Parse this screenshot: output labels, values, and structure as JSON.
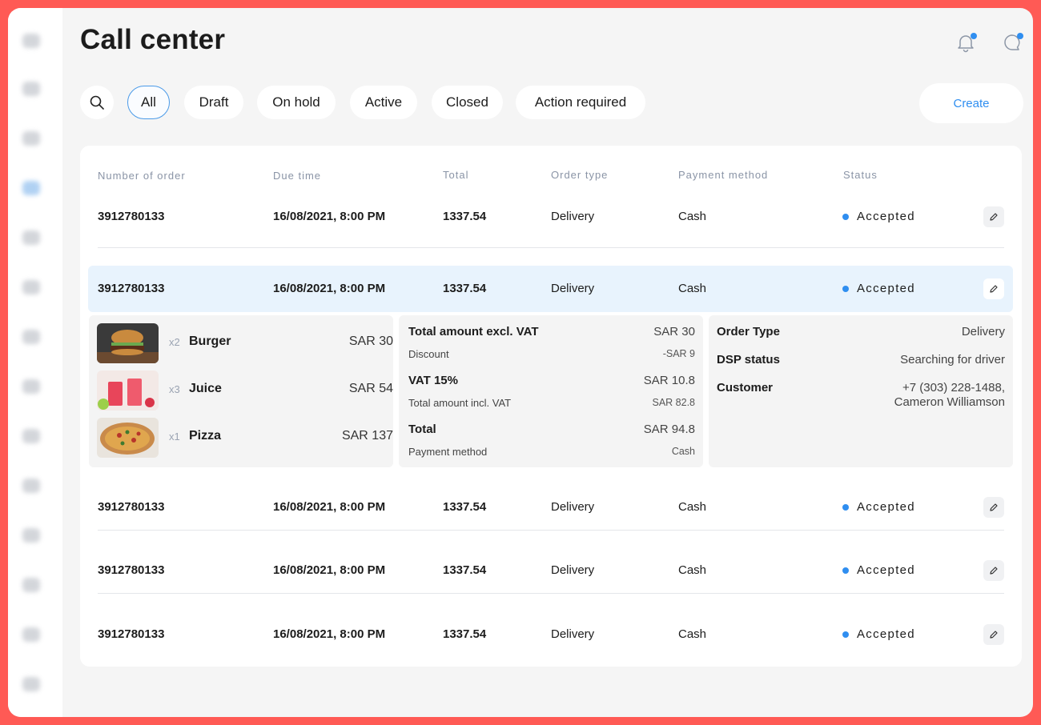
{
  "page": {
    "title": "Call center"
  },
  "filters": [
    "All",
    "Draft",
    "On hold",
    "Active",
    "Closed",
    "Action required"
  ],
  "create_label": "Create",
  "table": {
    "headers": [
      "Number of order",
      "Due time",
      "Total",
      "Order type",
      "Payment method",
      "Status"
    ],
    "rows": [
      {
        "number": "3912780133",
        "due": "16/08/2021, 8:00 PM",
        "total": "1337.54",
        "type": "Delivery",
        "payment": "Cash",
        "status": "Accepted"
      },
      {
        "number": "3912780133",
        "due": "16/08/2021, 8:00 PM",
        "total": "1337.54",
        "type": "Delivery",
        "payment": "Cash",
        "status": "Accepted"
      },
      {
        "number": "3912780133",
        "due": "16/08/2021, 8:00 PM",
        "total": "1337.54",
        "type": "Delivery",
        "payment": "Cash",
        "status": "Accepted"
      },
      {
        "number": "3912780133",
        "due": "16/08/2021, 8:00 PM",
        "total": "1337.54",
        "type": "Delivery",
        "payment": "Cash",
        "status": "Accepted"
      },
      {
        "number": "3912780133",
        "due": "16/08/2021, 8:00 PM",
        "total": "1337.54",
        "type": "Delivery",
        "payment": "Cash",
        "status": "Accepted"
      }
    ]
  },
  "details": {
    "items": [
      {
        "qty": "x2",
        "name": "Burger",
        "price": "SAR 30",
        "icon": "burger-image"
      },
      {
        "qty": "x3",
        "name": "Juice",
        "price": "SAR 54",
        "icon": "juice-image"
      },
      {
        "qty": "x1",
        "name": "Pizza",
        "price": "SAR 137",
        "icon": "pizza-image"
      }
    ],
    "summary": {
      "excl_label": "Total amount excl. VAT",
      "excl_value": "SAR 30",
      "discount_label": "Discount",
      "discount_value": "-SAR 9",
      "vat_label": "VAT 15%",
      "vat_value": "SAR 10.8",
      "incl_label": "Total amount incl. VAT",
      "incl_value": "SAR 82.8",
      "total_label": "Total",
      "total_value": "SAR 94.8",
      "payment_label": "Payment method",
      "payment_value": "Cash"
    },
    "info": {
      "order_type_label": "Order Type",
      "order_type_value": "Delivery",
      "dsp_label": "DSP status",
      "dsp_value": "Searching for driver",
      "customer_label": "Customer",
      "customer_phone": "+7 (303) 228-1488,",
      "customer_name": "Cameron Williamson"
    }
  },
  "colors": {
    "accent": "#2f8ef0",
    "frame": "#ff5a55",
    "expanded_row": "#e8f3fd"
  }
}
